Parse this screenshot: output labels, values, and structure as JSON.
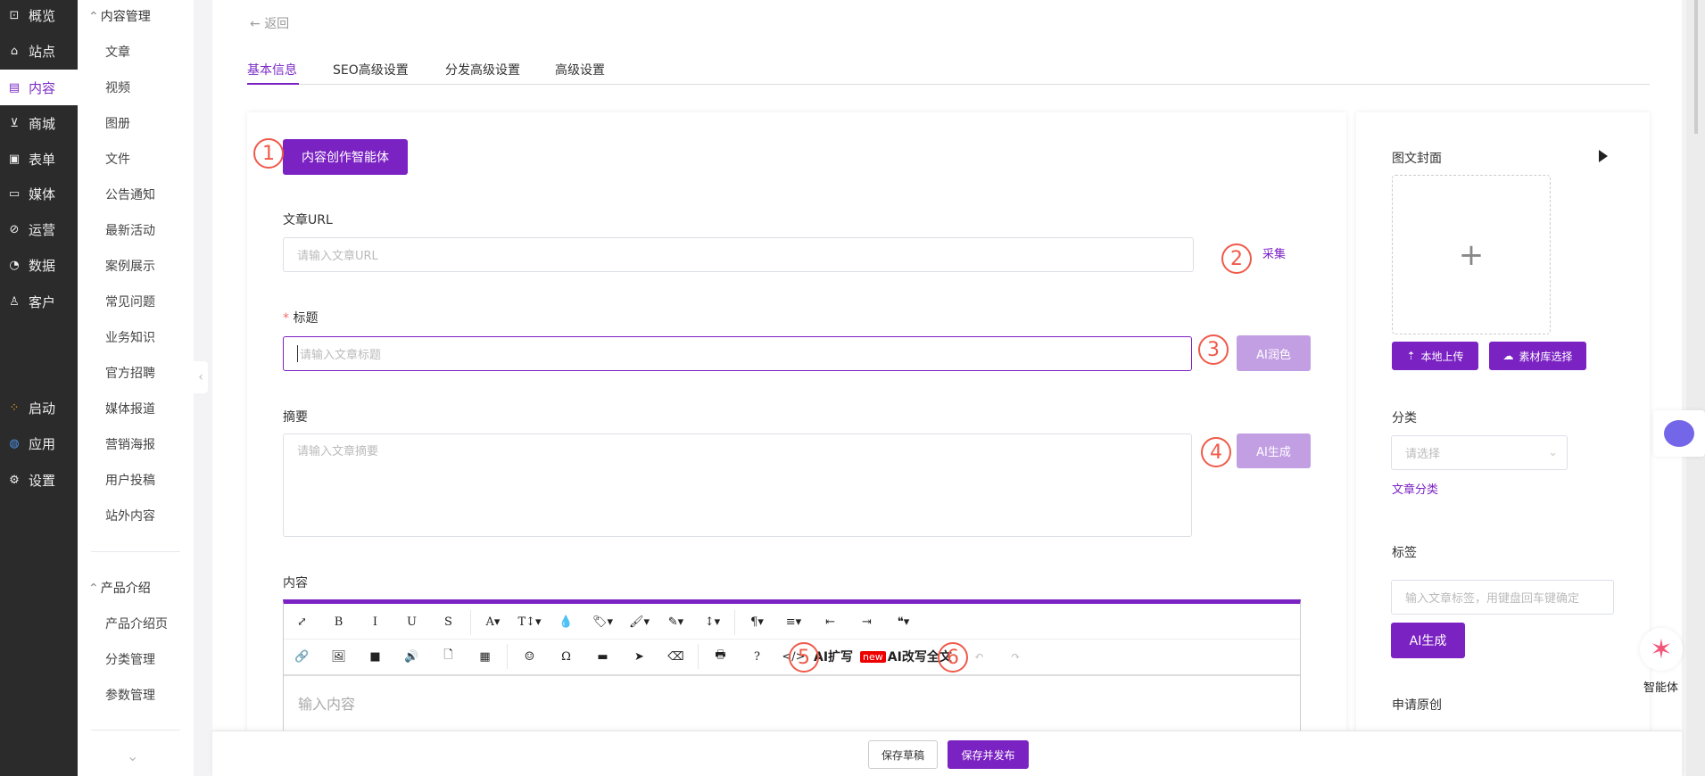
{
  "nav": {
    "items": [
      {
        "label": "概览",
        "icon": "chart-board-icon"
      },
      {
        "label": "站点",
        "icon": "home-icon"
      },
      {
        "label": "内容",
        "icon": "document-icon",
        "active": true
      },
      {
        "label": "商城",
        "icon": "cart-icon"
      },
      {
        "label": "表单",
        "icon": "form-icon"
      },
      {
        "label": "媒体",
        "icon": "video-icon"
      },
      {
        "label": "运营",
        "icon": "paperclip-icon"
      },
      {
        "label": "数据",
        "icon": "pie-chart-icon"
      },
      {
        "label": "客户",
        "icon": "user-icon"
      }
    ],
    "apps": [
      {
        "label": "启动",
        "icon": "launch-dots-icon"
      },
      {
        "label": "应用",
        "icon": "apps-ring-icon"
      },
      {
        "label": "设置",
        "icon": "gear-icon"
      }
    ]
  },
  "subnav": {
    "group1": {
      "title": "内容管理",
      "items": [
        "文章",
        "视频",
        "图册",
        "文件",
        "公告通知",
        "最新活动",
        "案例展示",
        "常见问题",
        "业务知识",
        "官方招聘",
        "媒体报道",
        "营销海报",
        "用户投稿",
        "站外内容"
      ]
    },
    "group2": {
      "title": "产品介绍",
      "items": [
        "产品介绍页",
        "分类管理",
        "参数管理"
      ]
    }
  },
  "header": {
    "back": "返回",
    "tabs": [
      "基本信息",
      "SEO高级设置",
      "分发高级设置",
      "高级设置"
    ]
  },
  "form": {
    "agent_button": "内容创作智能体",
    "url_label": "文章URL",
    "url_placeholder": "请输入文章URL",
    "collect_link": "采集",
    "title_required": "*",
    "title_label": "标题",
    "title_placeholder": "请输入文章标题",
    "polish_button": "AI润色",
    "summary_label": "摘要",
    "summary_placeholder": "请输入文章摘要",
    "summary_ai_button": "AI生成",
    "content_label": "内容",
    "content_placeholder": "输入内容",
    "toolbar_row1": [
      "⤢",
      "B",
      "I",
      "U",
      "S",
      "A▾",
      "T↕▾",
      "💧",
      "🏷▾",
      "🖌▾",
      "✎▾",
      "↕▾",
      "¶▾",
      "≡▾",
      "⇤",
      "⇥",
      "❝▾"
    ],
    "toolbar_row2": [
      "🔗",
      "🖼",
      "■",
      "🔊",
      "🗋",
      "▦",
      "☺",
      "Ω",
      "▬",
      "➤",
      "⌫",
      "🖶",
      "?"
    ],
    "code_icon": "</>",
    "ai_expand": "AI扩写",
    "new_badge": "new",
    "ai_rewrite": "AI改写全文",
    "undo": "↶",
    "redo": "↷"
  },
  "markers": [
    "1",
    "2",
    "3",
    "4",
    "5",
    "6"
  ],
  "side": {
    "cover_label": "图文封面",
    "upload_local": "本地上传",
    "material_select": "素材库选择",
    "category_label": "分类",
    "category_placeholder": "请选择",
    "category_link": "文章分类",
    "tag_label": "标签",
    "tag_placeholder": "输入文章标签，用键盘回车键确定",
    "tag_ai_button": "AI生成",
    "original_label": "申请原创"
  },
  "float": {
    "agent_label": "智能体"
  },
  "footer": {
    "draft": "保存草稿",
    "publish": "保存并发布"
  },
  "colors": {
    "accent": "#7b22c3",
    "light_accent": "#c29ee3",
    "marker": "#f05a4a",
    "nav_bg": "#2b2b2b"
  }
}
